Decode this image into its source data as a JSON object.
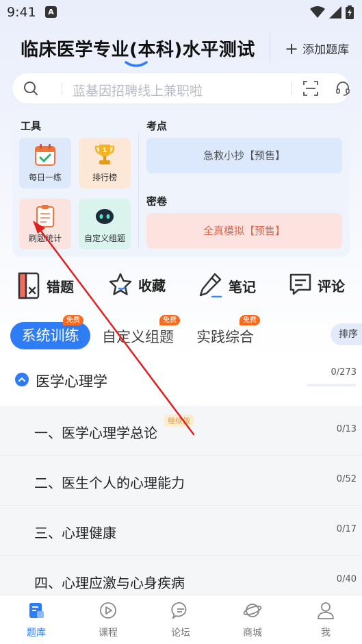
{
  "status": {
    "time": "9:41",
    "notif_letter": "A"
  },
  "header": {
    "title": "临床医学专业(本科)水平测试",
    "add_label": "添加题库"
  },
  "search": {
    "placeholder": "蓝基因招聘线上兼职啦"
  },
  "tools": {
    "heading": "工具",
    "items": [
      {
        "label": "每日一练",
        "icon": "calendar-check-icon"
      },
      {
        "label": "排行榜",
        "icon": "trophy-icon"
      },
      {
        "label": "刷题统计",
        "icon": "clipboard-icon"
      },
      {
        "label": "自定义组题",
        "icon": "robot-icon"
      }
    ]
  },
  "exam_points": {
    "heading": "考点",
    "promo": "急救小抄【预售】"
  },
  "secret_papers": {
    "heading": "密卷",
    "promo": "全真模拟【预售】"
  },
  "quick_actions": [
    {
      "label": "错题",
      "icon": "wrong-book-icon"
    },
    {
      "label": "收藏",
      "icon": "star-icon"
    },
    {
      "label": "笔记",
      "icon": "pen-icon"
    },
    {
      "label": "评论",
      "icon": "comment-icon"
    }
  ],
  "tabs": {
    "items": [
      {
        "label": "系统训练",
        "badge": "免费"
      },
      {
        "label": "自定义组题",
        "badge": "免费"
      },
      {
        "label": "实践综合",
        "badge": "免费"
      }
    ],
    "sort_label": "排序"
  },
  "chapter": {
    "title": "医学心理学",
    "count": "0/273",
    "progress": 0
  },
  "sections": [
    {
      "title": "一、医学心理学总论",
      "count": "0/13",
      "badge": "继续做"
    },
    {
      "title": "二、医生个人的心理能力",
      "count": "0/52"
    },
    {
      "title": "三、心理健康",
      "count": "0/17"
    },
    {
      "title": "四、心理应激与心身疾病",
      "count": "0/40"
    }
  ],
  "bottom_nav": [
    {
      "label": "题库",
      "icon": "question-bank-icon",
      "active": true
    },
    {
      "label": "课程",
      "icon": "play-circle-icon"
    },
    {
      "label": "论坛",
      "icon": "forum-icon"
    },
    {
      "label": "商城",
      "icon": "planet-icon"
    },
    {
      "label": "我",
      "icon": "user-icon"
    }
  ],
  "colors": {
    "accent": "#2f7df6",
    "badge": "#ff6a1a",
    "annotation": "#e02020"
  }
}
